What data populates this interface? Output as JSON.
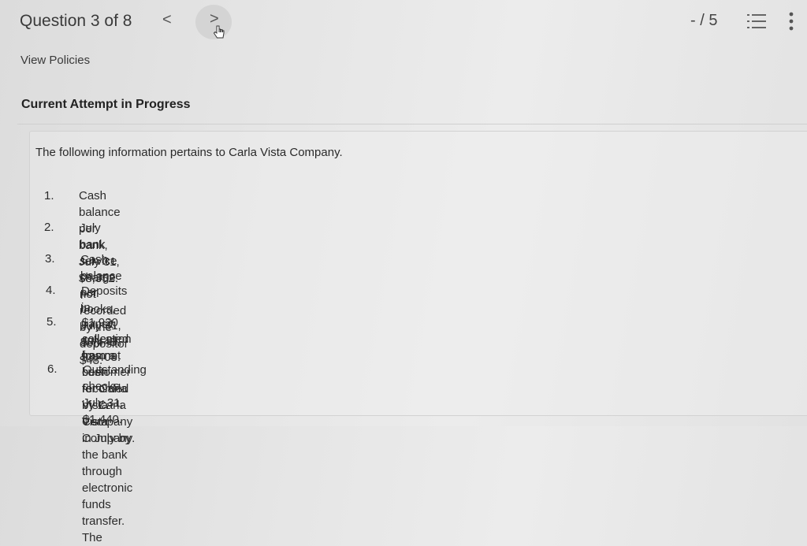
{
  "header": {
    "question_label": "Question 3 of 8",
    "prev_glyph": "<",
    "next_glyph": ">",
    "score": "- / 5"
  },
  "links": {
    "view_policies": "View Policies"
  },
  "status": {
    "attempt": "Current Attempt in Progress"
  },
  "problem": {
    "intro": "The following information pertains to Carla Vista Company.",
    "items": [
      {
        "num": "1.",
        "text": "Cash balance per bank, July 31, $8,352."
      },
      {
        "num": "2.",
        "text": "July bank service charge not recorded by the depositor $48."
      },
      {
        "num": "3.",
        "text": "Cash balance per books, July 31, $8,448."
      },
      {
        "num": "4.",
        "text": "Deposits in transit, July 31, $3,408."
      },
      {
        "num": "5.",
        "text": "$1,920 collected from a customer for Carla Vista Company in July by the bank through electronic funds transfer. The",
        "text2": "collection has not been recorded by Carla Vista Company."
      },
      {
        "num": "6.",
        "text": "Outstanding checks, July 31, $1,440."
      }
    ]
  },
  "icons": {
    "list": "numbered-list-icon",
    "more": "more-vertical-icon",
    "cursor": "hand-pointer-icon"
  }
}
